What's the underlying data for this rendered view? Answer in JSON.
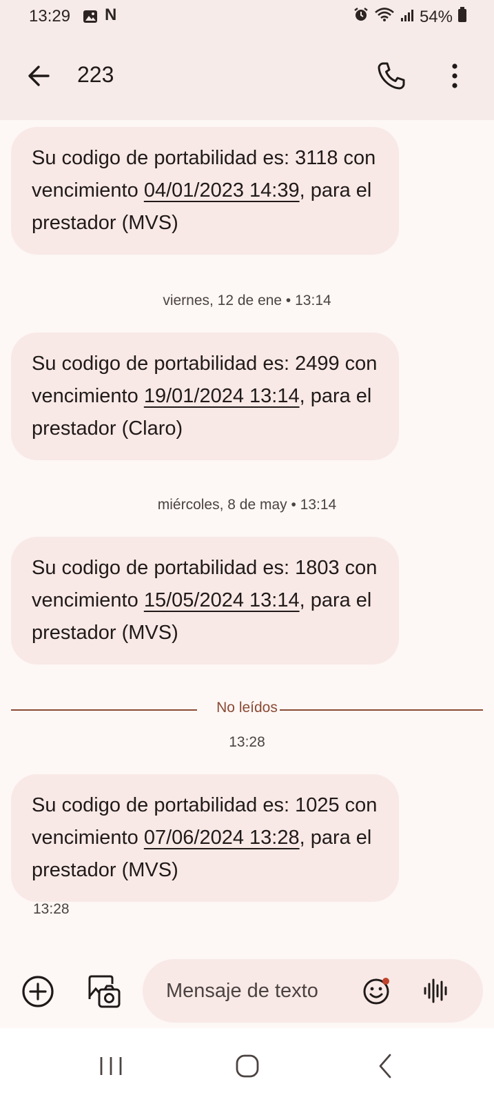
{
  "status_bar": {
    "time": "13:29",
    "left_icons": [
      "gallery-icon",
      "netflix-icon"
    ],
    "netflix_glyph": "N",
    "right_icons": [
      "alarm-icon",
      "wifi-icon",
      "signal-icon",
      "battery-icon"
    ],
    "battery": "54%"
  },
  "header": {
    "title": "223",
    "icons": [
      "back-arrow-icon",
      "phone-icon",
      "more-vert-icon"
    ]
  },
  "thread": {
    "messages": [
      {
        "prefix": "Su codigo de portabilidad es: 3118 con vencimiento ",
        "date": "04/01/2023 14:39",
        "suffix": ", para el prestador (MVS)"
      },
      {
        "prefix": "Su codigo de portabilidad es: 2499 con vencimiento ",
        "date": "19/01/2024 13:14",
        "suffix": ", para el prestador (Claro)"
      },
      {
        "prefix": "Su codigo de portabilidad es: 1803 con vencimiento ",
        "date": "15/05/2024 13:14",
        "suffix": ", para el prestador (MVS)"
      },
      {
        "prefix": "Su codigo de portabilidad es: 1025 con vencimiento ",
        "date": "07/06/2024 13:28",
        "suffix": ", para el prestador (MVS)"
      }
    ],
    "separators": [
      "viernes, 12 de ene • 13:14",
      "miércoles, 8 de may • 13:14"
    ],
    "unread_label": "No leídos",
    "unread_time": "13:28",
    "last_message_time": "13:28"
  },
  "composer": {
    "placeholder": "Mensaje de texto",
    "icons": [
      "add-circle-icon",
      "gallery-camera-icon",
      "emoji-icon",
      "voice-waveform-icon"
    ]
  },
  "nav_bar": {
    "icons": [
      "recents-icon",
      "home-icon",
      "back-icon"
    ]
  },
  "colors": {
    "app_bar": "#f6ebe8",
    "background": "#fdf7f5",
    "bubble": "#f8e9e6",
    "accent": "#8a4a34",
    "text": "#1f1a19"
  }
}
